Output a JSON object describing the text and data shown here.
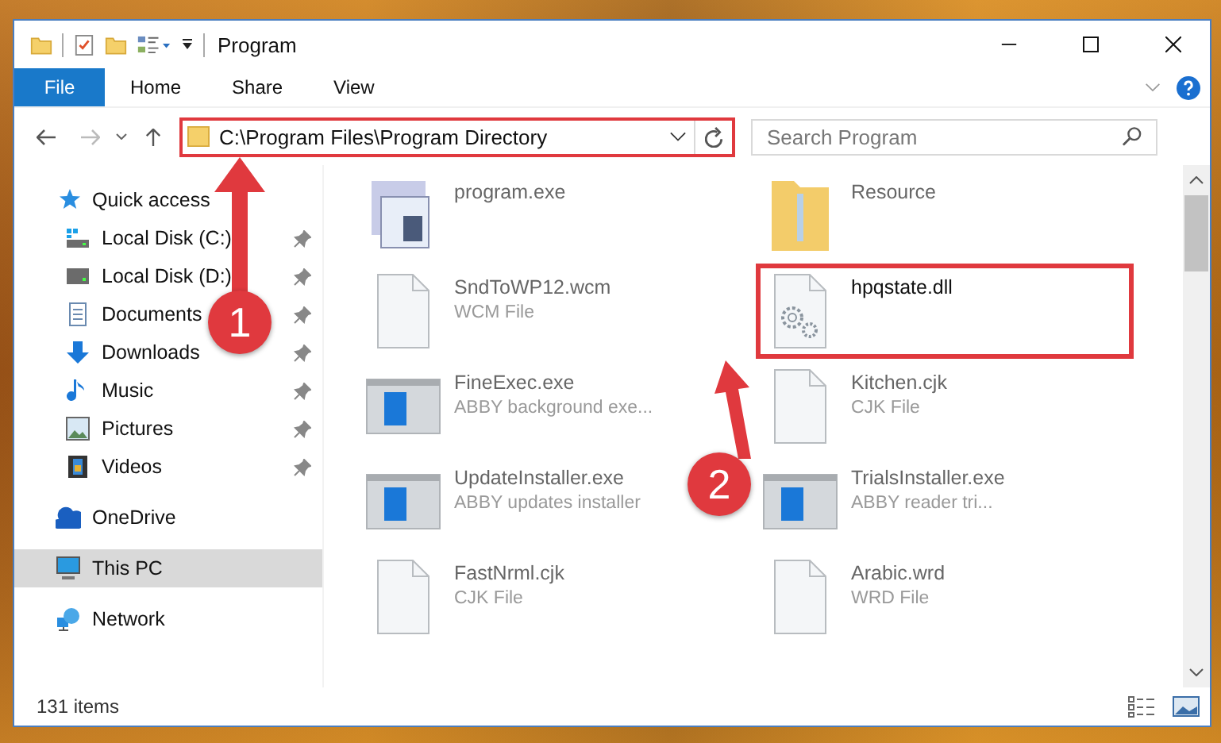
{
  "window": {
    "title": "Program"
  },
  "ribbon_tabs": [
    {
      "label": "File",
      "kind": "file"
    },
    {
      "label": "Home",
      "kind": "tab"
    },
    {
      "label": "Share",
      "kind": "tab"
    },
    {
      "label": "View",
      "kind": "tab"
    }
  ],
  "address": {
    "path": "C:\\Program Files\\Program Directory",
    "framed": true
  },
  "search": {
    "placeholder": "Search Program"
  },
  "navigation": [
    {
      "label": "Quick access",
      "kind": "star",
      "selected": false,
      "children": [
        {
          "label": "Local Disk (C:)",
          "kind": "system-drive",
          "pinned": true,
          "selected": false
        },
        {
          "label": "Local Disk (D:)",
          "kind": "drive",
          "pinned": true,
          "selected": false
        },
        {
          "label": "Documents",
          "kind": "documents",
          "pinned": true,
          "selected": false
        },
        {
          "label": "Downloads",
          "kind": "downloads",
          "pinned": true,
          "selected": false
        },
        {
          "label": "Music",
          "kind": "music",
          "pinned": true,
          "selected": false
        },
        {
          "label": "Pictures",
          "kind": "pictures",
          "pinned": true,
          "selected": false
        },
        {
          "label": "Videos",
          "kind": "videos",
          "pinned": true,
          "selected": false
        }
      ]
    },
    {
      "label": "OneDrive",
      "kind": "cloud",
      "selected": false
    },
    {
      "label": "This PC",
      "kind": "computer",
      "selected": true
    },
    {
      "label": "Network",
      "kind": "network",
      "selected": false
    }
  ],
  "files": [
    {
      "name": "program.exe",
      "kind": "exe",
      "framed": false
    },
    {
      "name": "Resource",
      "kind": "folder",
      "framed": false
    },
    {
      "name": "SndToWP12.wcm",
      "type": "WCM File",
      "kind": "document",
      "framed": false
    },
    {
      "name": "hpqstate.dll",
      "kind": "dll",
      "framed": true
    },
    {
      "name": "FineExec.exe",
      "type": "ABBY background exe...",
      "kind": "app",
      "framed": false
    },
    {
      "name": "Kitchen.cjk",
      "type": "CJK File",
      "kind": "document",
      "framed": false
    },
    {
      "name": "UpdateInstaller.exe",
      "type": "ABBY updates installer",
      "kind": "app",
      "framed": false
    },
    {
      "name": "TrialsInstaller.exe",
      "type": "ABBY reader tri...",
      "kind": "app",
      "framed": false
    },
    {
      "name": "FastNrml.cjk",
      "type": "CJK File",
      "kind": "document",
      "framed": false
    },
    {
      "name": "Arabic.wrd",
      "type": "WRD File",
      "kind": "document",
      "framed": false
    }
  ],
  "annotations": [
    {
      "label": "1"
    },
    {
      "label": "2"
    }
  ],
  "status_bar": {
    "item_count": "131 items"
  }
}
